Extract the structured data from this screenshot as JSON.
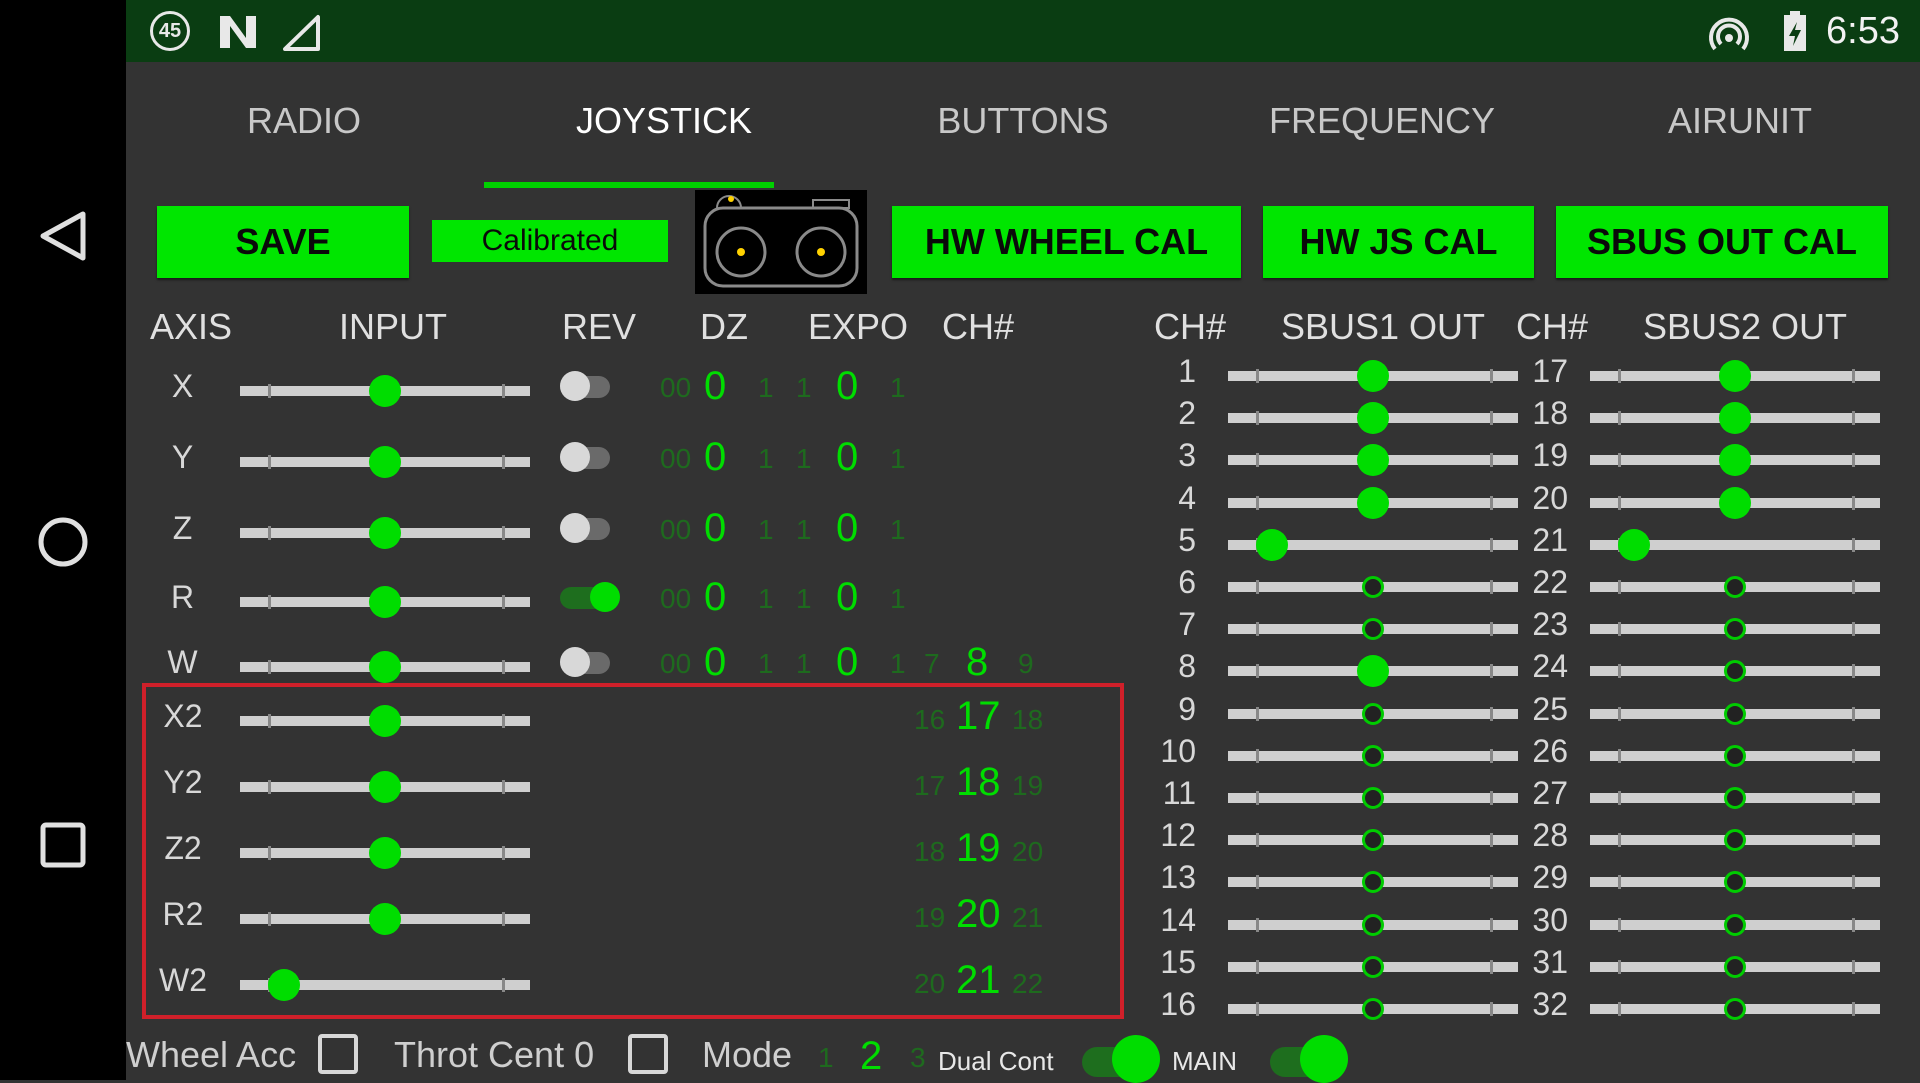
{
  "status_bar": {
    "badge": "45",
    "time": "6:53",
    "icons": [
      "badge-45-icon",
      "n-logo-icon",
      "signal-icon",
      "hotspot-icon",
      "battery-icon"
    ]
  },
  "nav_bar": {
    "icons": [
      "back-icon",
      "home-icon",
      "recents-icon"
    ]
  },
  "tabs": [
    {
      "label": "RADIO",
      "active": false
    },
    {
      "label": "JOYSTICK",
      "active": true
    },
    {
      "label": "BUTTONS",
      "active": false
    },
    {
      "label": "FREQUENCY",
      "active": false
    },
    {
      "label": "AIRUNIT",
      "active": false
    }
  ],
  "toolbar": {
    "save_label": "SAVE",
    "status_label": "Calibrated",
    "hw_wheel_cal_label": "HW WHEEL CAL",
    "hw_js_cal_label": "HW JS CAL",
    "sbus_out_cal_label": "SBUS OUT CAL",
    "controller_image": "controller-icon"
  },
  "left_headers": {
    "axis": "AXIS",
    "input": "INPUT",
    "rev": "REV",
    "dz": "DZ",
    "expo": "EXPO",
    "ch": "CH#"
  },
  "right_headers": {
    "ch1": "CH#",
    "sbus1": "SBUS1 OUT",
    "ch2": "CH#",
    "sbus2": "SBUS2 OUT"
  },
  "axes": [
    {
      "name": "X",
      "input": 0.5,
      "rev": false,
      "dz_prev": "00",
      "dz": "0",
      "dz_next": "1",
      "expo_prev": "1",
      "expo": "0",
      "expo_next": "1"
    },
    {
      "name": "Y",
      "input": 0.5,
      "rev": false,
      "dz_prev": "00",
      "dz": "0",
      "dz_next": "1",
      "expo_prev": "1",
      "expo": "0",
      "expo_next": "1"
    },
    {
      "name": "Z",
      "input": 0.5,
      "rev": false,
      "dz_prev": "00",
      "dz": "0",
      "dz_next": "1",
      "expo_prev": "1",
      "expo": "0",
      "expo_next": "1"
    },
    {
      "name": "R",
      "input": 0.5,
      "rev": true,
      "dz_prev": "00",
      "dz": "0",
      "dz_next": "1",
      "expo_prev": "1",
      "expo": "0",
      "expo_next": "1"
    },
    {
      "name": "W",
      "input": 0.5,
      "rev": false,
      "dz_prev": "00",
      "dz": "0",
      "dz_next": "1",
      "expo_prev": "1",
      "expo": "0",
      "expo_next": "1",
      "ch_prev": "7",
      "ch": "8",
      "ch_next": "9"
    }
  ],
  "axes2": [
    {
      "name": "X2",
      "input": 0.5,
      "ch_prev": "16",
      "ch": "17",
      "ch_next": "18"
    },
    {
      "name": "Y2",
      "input": 0.5,
      "ch_prev": "17",
      "ch": "18",
      "ch_next": "19"
    },
    {
      "name": "Z2",
      "input": 0.5,
      "ch_prev": "18",
      "ch": "19",
      "ch_next": "20"
    },
    {
      "name": "R2",
      "input": 0.5,
      "ch_prev": "19",
      "ch": "20",
      "ch_next": "21"
    },
    {
      "name": "W2",
      "input": 0.15,
      "ch_prev": "20",
      "ch": "21",
      "ch_next": "22"
    }
  ],
  "sbus1": [
    {
      "ch": "1",
      "value": 0.5,
      "active": true
    },
    {
      "ch": "2",
      "value": 0.5,
      "active": true
    },
    {
      "ch": "3",
      "value": 0.5,
      "active": true
    },
    {
      "ch": "4",
      "value": 0.5,
      "active": true
    },
    {
      "ch": "5",
      "value": 0.15,
      "active": true
    },
    {
      "ch": "6",
      "value": 0.5,
      "active": false
    },
    {
      "ch": "7",
      "value": 0.5,
      "active": false
    },
    {
      "ch": "8",
      "value": 0.5,
      "active": true
    },
    {
      "ch": "9",
      "value": 0.5,
      "active": false
    },
    {
      "ch": "10",
      "value": 0.5,
      "active": false
    },
    {
      "ch": "11",
      "value": 0.5,
      "active": false
    },
    {
      "ch": "12",
      "value": 0.5,
      "active": false
    },
    {
      "ch": "13",
      "value": 0.5,
      "active": false
    },
    {
      "ch": "14",
      "value": 0.5,
      "active": false
    },
    {
      "ch": "15",
      "value": 0.5,
      "active": false
    },
    {
      "ch": "16",
      "value": 0.5,
      "active": false
    }
  ],
  "sbus2": [
    {
      "ch": "17",
      "value": 0.5,
      "active": true
    },
    {
      "ch": "18",
      "value": 0.5,
      "active": true
    },
    {
      "ch": "19",
      "value": 0.5,
      "active": true
    },
    {
      "ch": "20",
      "value": 0.5,
      "active": true
    },
    {
      "ch": "21",
      "value": 0.15,
      "active": true
    },
    {
      "ch": "22",
      "value": 0.5,
      "active": false
    },
    {
      "ch": "23",
      "value": 0.5,
      "active": false
    },
    {
      "ch": "24",
      "value": 0.5,
      "active": false
    },
    {
      "ch": "25",
      "value": 0.5,
      "active": false
    },
    {
      "ch": "26",
      "value": 0.5,
      "active": false
    },
    {
      "ch": "27",
      "value": 0.5,
      "active": false
    },
    {
      "ch": "28",
      "value": 0.5,
      "active": false
    },
    {
      "ch": "29",
      "value": 0.5,
      "active": false
    },
    {
      "ch": "30",
      "value": 0.5,
      "active": false
    },
    {
      "ch": "31",
      "value": 0.5,
      "active": false
    },
    {
      "ch": "32",
      "value": 0.5,
      "active": false
    }
  ],
  "bottom": {
    "wheel_acc_label": "Wheel Acc",
    "wheel_acc_checked": false,
    "throt_cent_label": "Throt Cent 0",
    "throt_cent_checked": false,
    "mode_label": "Mode",
    "mode_prev": "1",
    "mode_value": "2",
    "mode_next": "3",
    "dual_cont_label": "Dual Cont",
    "dual_cont_on": true,
    "main_label": "MAIN",
    "main_on": true
  },
  "colors": {
    "accent": "#00e600",
    "status_bar": "#0a3d12",
    "background": "#333333",
    "highlight_border": "#d0202a"
  }
}
